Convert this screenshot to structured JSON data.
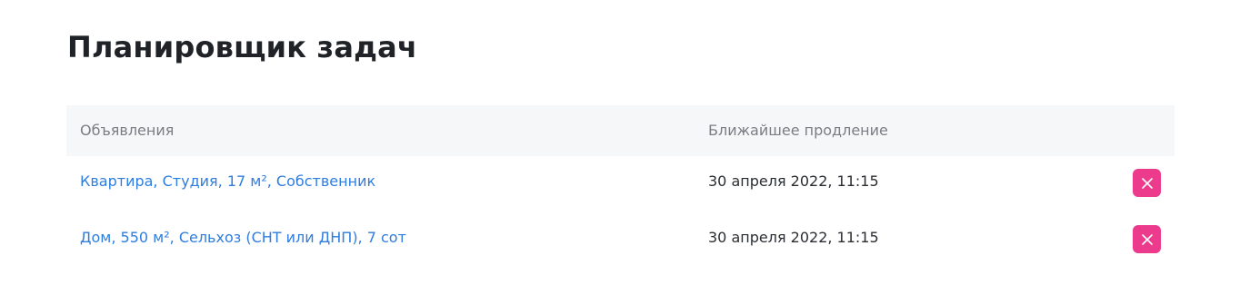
{
  "page": {
    "title": "Планировщик задач"
  },
  "table": {
    "headers": {
      "ads": "Объявления",
      "next_renewal": "Ближайшее продление"
    },
    "rows": [
      {
        "ad": "Квартира, Студия, 17 м², Собственник",
        "renewal": "30 апреля 2022, 11:15",
        "delete_icon": "close-icon"
      },
      {
        "ad": "Дом, 550 м², Сельхоз (СНТ или ДНП), 7 сот",
        "renewal": "30 апреля 2022, 11:15",
        "delete_icon": "close-icon"
      }
    ]
  },
  "colors": {
    "link": "#2f7ddf",
    "delete_button": "#ec3b8d",
    "header_background": "#f6f7f9"
  }
}
